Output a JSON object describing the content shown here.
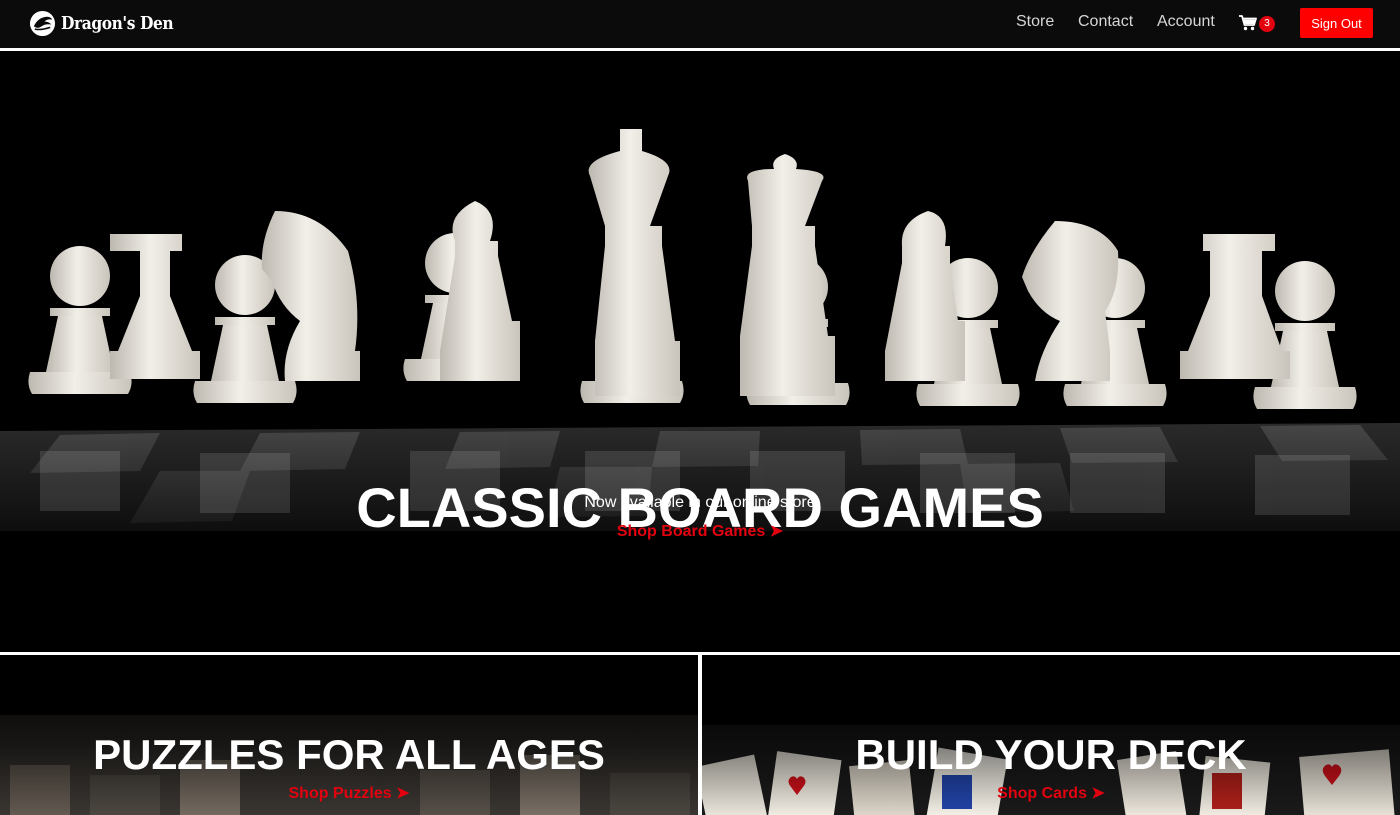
{
  "nav": {
    "brand": "Dragon's Den",
    "links": [
      "Store",
      "Contact",
      "Account"
    ],
    "cart_count": "3",
    "signout_label": "Sign Out"
  },
  "hero": {
    "title": "CLASSIC BOARD GAMES",
    "subtitle": "Now available in our online store",
    "cta": "Shop Board Games ➤"
  },
  "panels": [
    {
      "title": "PUZZLES FOR ALL AGES",
      "cta": "Shop Puzzles ➤"
    },
    {
      "title": "BUILD YOUR DECK",
      "cta": "Shop Cards ➤"
    }
  ],
  "colors": {
    "accent": "#e3000f",
    "navbar": "#0b0b0b",
    "background": "#000000",
    "text": "#ffffff"
  },
  "icons": [
    "dragon-logo-icon",
    "shopping-cart-icon"
  ]
}
